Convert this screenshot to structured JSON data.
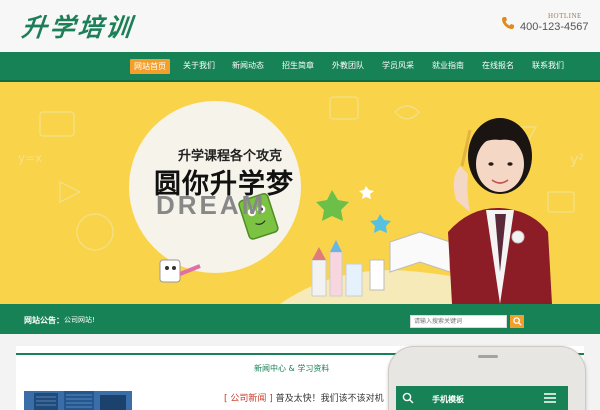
{
  "header": {
    "logo_text": "升学培训",
    "hotline_label": "HOTLINE",
    "hotline_number": "400-123-4567"
  },
  "nav": {
    "items": [
      {
        "label": "网站首页",
        "active": true
      },
      {
        "label": "关于我们"
      },
      {
        "label": "新闻动态"
      },
      {
        "label": "招生简章"
      },
      {
        "label": "外教团队"
      },
      {
        "label": "学员风采"
      },
      {
        "label": "就业指南"
      },
      {
        "label": "在线报名"
      },
      {
        "label": "联系我们"
      }
    ]
  },
  "banner": {
    "subtitle": "升学课程各个攻克",
    "title": "圆你升学梦",
    "dream": "DREAM"
  },
  "notice": {
    "label": "网站公告：",
    "text": "公司网站!"
  },
  "search": {
    "placeholder": "请输入搜索关键词"
  },
  "content": {
    "section_title": "新闻中心 & 学习资料",
    "news_tag": "[ 公司新闻 ]",
    "news_headline": " 普及太快！我们该不该对机"
  },
  "phone": {
    "title": "手机模板"
  },
  "colors": {
    "brand_green": "#188257",
    "accent_orange": "#f2a02b",
    "banner_yellow": "#f9d44a"
  }
}
